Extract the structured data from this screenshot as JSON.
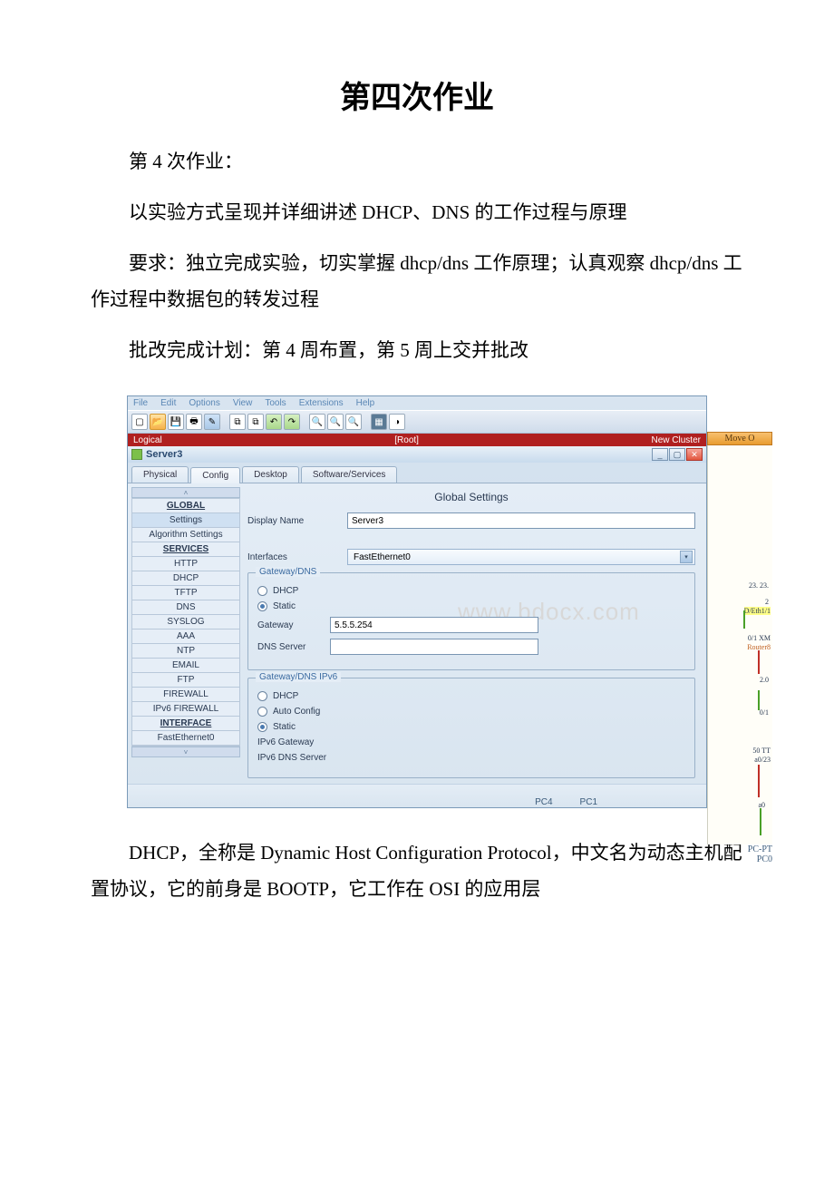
{
  "doc": {
    "title": "第四次作业",
    "p1": "第 4 次作业：",
    "p2": "以实验方式呈现并详细讲述 DHCP、DNS 的工作过程与原理",
    "p3": "要求：独立完成实验，切实掌握 dhcp/dns 工作原理；认真观察 dhcp/dns 工作过程中数据包的转发过程",
    "p4": "批改完成计划：第 4 周布置，第 5 周上交并批改",
    "p5": "DHCP，全称是 Dynamic Host Configuration Protocol，中文名为动态主机配置协议，它的前身是 BOOTP，它工作在 OSI 的应用层"
  },
  "app": {
    "menubar": [
      "File",
      "Edit",
      "Options",
      "View",
      "Tools",
      "Extensions",
      "Help"
    ],
    "logical_left": "Logical",
    "logical_center": "[Root]",
    "logical_right": "New Cluster",
    "move_obj": "Move O",
    "window_title": "Server3",
    "tabs": [
      "Physical",
      "Config",
      "Desktop",
      "Software/Services"
    ],
    "active_tab_index": 1,
    "sidebar": {
      "global": "GLOBAL",
      "settings": "Settings",
      "algorithm": "Algorithm Settings",
      "services": "SERVICES",
      "items": [
        "HTTP",
        "DHCP",
        "TFTP",
        "DNS",
        "SYSLOG",
        "AAA",
        "NTP",
        "EMAIL",
        "FTP",
        "FIREWALL",
        "IPv6 FIREWALL"
      ],
      "interface": "INTERFACE",
      "fast": "FastEthernet0"
    },
    "main": {
      "title": "Global Settings",
      "display_name_label": "Display Name",
      "display_name_value": "Server3",
      "interfaces_label": "Interfaces",
      "interfaces_value": "FastEthernet0",
      "fs1_legend": "Gateway/DNS",
      "r_dhcp": "DHCP",
      "r_static": "Static",
      "gateway_label": "Gateway",
      "gateway_value": "5.5.5.254",
      "dns_label": "DNS Server",
      "fs2_legend": "Gateway/DNS IPv6",
      "r_dhcp6": "DHCP",
      "r_auto": "Auto Config",
      "r_static6": "Static",
      "ipv6_gw": "IPv6 Gateway",
      "ipv6_dns": "IPv6 DNS Server"
    },
    "wm": "www.bdocx.com",
    "right": {
      "l1": "23. 23.",
      "l2": "2",
      "l3": "D/Eth1/1",
      "l4": "0/1 XM",
      "l5": "Router8",
      "l6": "2.0",
      "l7": "0/1",
      "l8": "50 TT",
      "l9": "a0/23",
      "l10": "a0"
    },
    "footer": {
      "pc4": "PC4",
      "pc1": "PC1",
      "pcpt": "PC-PT",
      "pc0": "PC0"
    }
  }
}
